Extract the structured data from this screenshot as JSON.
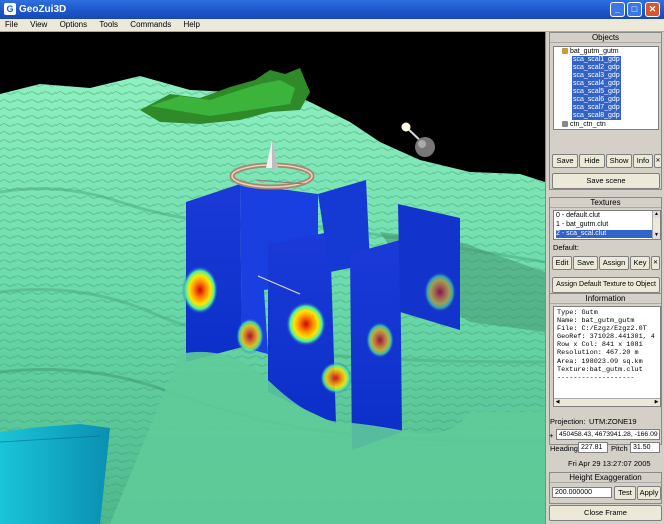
{
  "window": {
    "title": "GeoZui3D",
    "app_icon": "G",
    "minimize": "_",
    "maximize": "□",
    "close": "✕"
  },
  "menu": [
    "File",
    "View",
    "Options",
    "Tools",
    "Commands",
    "Help"
  ],
  "objects": {
    "title": "Objects",
    "items": [
      {
        "label": "bat_gutm_gutm",
        "selected": false
      },
      {
        "label": "sca_scal1_gdp",
        "selected": true
      },
      {
        "label": "sca_scal2_gdp",
        "selected": true
      },
      {
        "label": "sca_scal3_gdp",
        "selected": true
      },
      {
        "label": "sca_scal4_gdp",
        "selected": true
      },
      {
        "label": "sca_scal5_gdp",
        "selected": true
      },
      {
        "label": "sca_scal6_gdp",
        "selected": true
      },
      {
        "label": "sca_scal7_gdp",
        "selected": true
      },
      {
        "label": "sca_scal8_gdp",
        "selected": true
      },
      {
        "label": "ctn_ctn_ctn",
        "selected": false
      }
    ],
    "buttons": {
      "save": "Save",
      "hide": "Hide",
      "show": "Show",
      "info": "Info"
    },
    "save_scene": "Save scene"
  },
  "textures": {
    "title": "Textures",
    "items": [
      {
        "label": "0 - default.clut",
        "selected": false
      },
      {
        "label": "1 - bat_gutm.clut",
        "selected": false
      },
      {
        "label": "2 - sca_scal.clut",
        "selected": true
      }
    ],
    "default_label": "Default:",
    "buttons": {
      "edit": "Edit",
      "save": "Save",
      "assign": "Assign",
      "key": "Key"
    },
    "assign_default": "Assign Default Texture to Object"
  },
  "information": {
    "title": "Information",
    "lines": [
      "Type:  Gutm",
      "Name:  bat_gutm_gutm",
      "File:  C:/Ezgz/Ezgz2.0T",
      "GeoRef: 371028.441301, 4",
      "Row x Col:  841 x 1081",
      "Resolution: 467.20 m",
      "Area:   198023.09 sq.km",
      "Texture:bat_gutm.clut",
      "-------------------"
    ]
  },
  "projection": {
    "label": "Projection:",
    "value": "UTM:ZONE19",
    "coords": "450458.43, 4673941.28, -166.09",
    "heading_label": "Heading",
    "heading": "227.81",
    "pitch_label": "Pitch",
    "pitch": "31.50",
    "datetime": "Fri Apr 29 13:27:07 2005"
  },
  "height": {
    "title": "Height Exaggeration",
    "value": "200.000000",
    "test": "Test",
    "apply": "Apply"
  },
  "close_frame": "Close Frame",
  "icons": {
    "app": "app-icon",
    "close_small": "close-icon",
    "scroll_up": "scroll-up-icon",
    "scroll_down": "scroll-down-icon"
  }
}
